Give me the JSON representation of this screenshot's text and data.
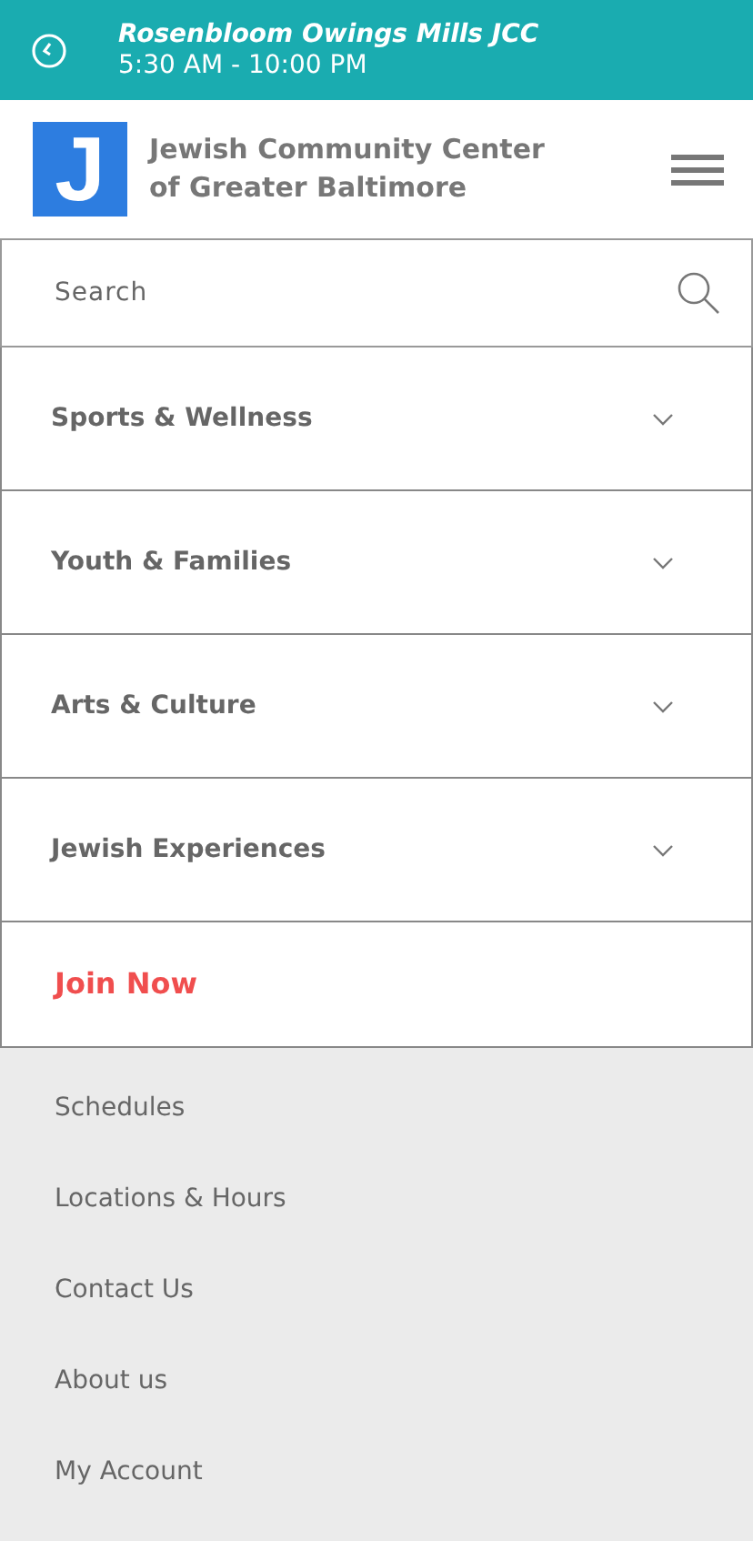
{
  "location_bar": {
    "name": "Rosenbloom Owings Mills JCC",
    "hours": "5:30 AM - 10:00 PM"
  },
  "header": {
    "logo_letter": "J",
    "title_line_1": "Jewish Community Center",
    "title_line_2": "of Greater Baltimore"
  },
  "search": {
    "placeholder": "Search"
  },
  "menu": [
    {
      "label": "Sports & Wellness",
      "kind": "category",
      "expanded": false
    },
    {
      "label": "Youth & Families",
      "kind": "category",
      "expanded": false
    },
    {
      "label": "Arts & Culture",
      "kind": "category",
      "expanded": false
    },
    {
      "label": "Jewish Experiences",
      "kind": "category",
      "expanded": false
    },
    {
      "label": "Join Now",
      "kind": "cta"
    }
  ],
  "secondary_links": [
    "Schedules",
    "Locations & Hours",
    "Contact Us",
    "About us",
    "My Account"
  ]
}
